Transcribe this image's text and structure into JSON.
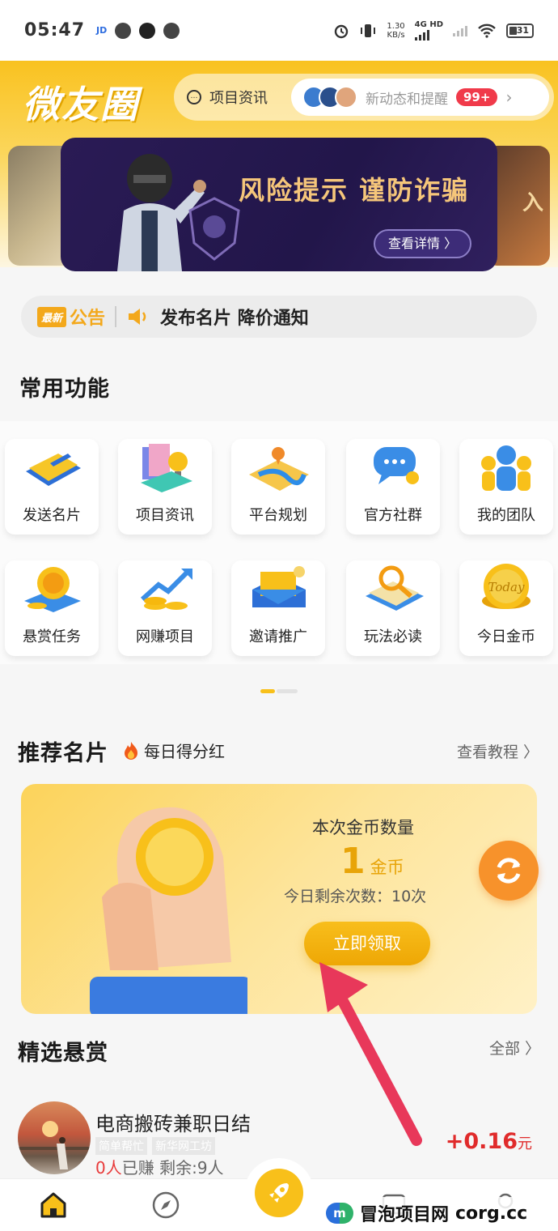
{
  "status_bar": {
    "time": "05:47",
    "net_speed": "1.30",
    "net_unit": "KB/s",
    "network": "4G HD",
    "battery": "31"
  },
  "header": {
    "logo": "微友圈",
    "news_label": "项目资讯",
    "updates_label": "新动态和提醒",
    "updates_badge": "99+"
  },
  "banner": {
    "title": "风险提示  谨防诈骗",
    "button": "查看详情 〉",
    "side_text": "入"
  },
  "notice": {
    "new_tag": "最新",
    "label": "公告",
    "text": "发布名片 降价通知"
  },
  "functions": {
    "title": "常用功能",
    "items": [
      {
        "label": "发送名片",
        "icon": "send-card-icon"
      },
      {
        "label": "项目资讯",
        "icon": "project-news-icon"
      },
      {
        "label": "平台规划",
        "icon": "platform-plan-icon"
      },
      {
        "label": "官方社群",
        "icon": "official-community-icon"
      },
      {
        "label": "我的团队",
        "icon": "my-team-icon"
      },
      {
        "label": "悬赏任务",
        "icon": "bounty-task-icon"
      },
      {
        "label": "网赚项目",
        "icon": "online-earning-icon"
      },
      {
        "label": "邀请推广",
        "icon": "invite-promote-icon"
      },
      {
        "label": "玩法必读",
        "icon": "guide-read-icon"
      },
      {
        "label": "今日金币",
        "icon": "today-coin-icon"
      }
    ]
  },
  "recommend": {
    "title": "推荐名片",
    "subtitle": "每日得分红",
    "link": "查看教程 〉"
  },
  "coin_card": {
    "title": "本次金币数量",
    "amount": "1",
    "unit": "金币",
    "remaining": "今日剩余次数：10次",
    "button": "立即领取",
    "coin_text": "Today"
  },
  "bounty": {
    "title": "精选悬赏",
    "link": "全部 〉",
    "task": {
      "title": "电商搬砖兼职日结",
      "tags": [
        "简单帮忙",
        "新华网工坊"
      ],
      "earned": "0人",
      "earned_suffix": "已赚  剩余:9人",
      "reward": "+0.16",
      "reward_unit": "元"
    }
  },
  "watermark": {
    "logo": "m",
    "name": "冒泡项目网",
    "url": "corg.cc"
  },
  "colors": {
    "brand_yellow": "#f8c01a",
    "reward_red": "#e02b2b",
    "badge_red": "#f03a4a",
    "refresh_orange": "#f7922b"
  }
}
